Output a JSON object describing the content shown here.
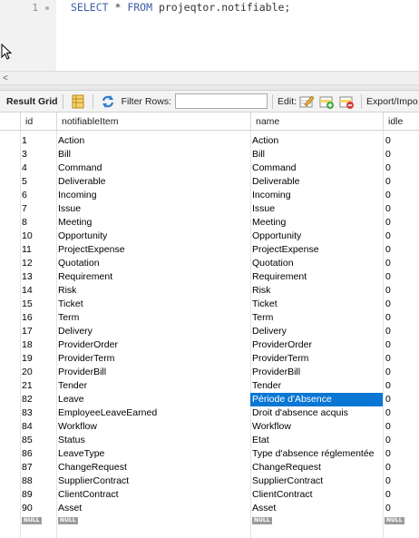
{
  "editor": {
    "line_number": "1",
    "sql_keyword_select": "SELECT",
    "sql_star": " * ",
    "sql_keyword_from": "FROM",
    "sql_table": " projeqtor.notifiable;"
  },
  "scrollbar": {
    "left_arrow": "<"
  },
  "toolbar": {
    "result_grid_label": "Result Grid",
    "filter_rows_label": "Filter Rows:",
    "filter_rows_value": "",
    "edit_label": "Edit:",
    "export_label": "Export/Impo"
  },
  "grid": {
    "columns": [
      "id",
      "notifiableItem",
      "name",
      "idle"
    ],
    "rows": [
      [
        "1",
        "Action",
        "Action",
        "0"
      ],
      [
        "3",
        "Bill",
        "Bill",
        "0"
      ],
      [
        "4",
        "Command",
        "Command",
        "0"
      ],
      [
        "5",
        "Deliverable",
        "Deliverable",
        "0"
      ],
      [
        "6",
        "Incoming",
        "Incoming",
        "0"
      ],
      [
        "7",
        "Issue",
        "Issue",
        "0"
      ],
      [
        "8",
        "Meeting",
        "Meeting",
        "0"
      ],
      [
        "10",
        "Opportunity",
        "Opportunity",
        "0"
      ],
      [
        "11",
        "ProjectExpense",
        "ProjectExpense",
        "0"
      ],
      [
        "12",
        "Quotation",
        "Quotation",
        "0"
      ],
      [
        "13",
        "Requirement",
        "Requirement",
        "0"
      ],
      [
        "14",
        "Risk",
        "Risk",
        "0"
      ],
      [
        "15",
        "Ticket",
        "Ticket",
        "0"
      ],
      [
        "16",
        "Term",
        "Term",
        "0"
      ],
      [
        "17",
        "Delivery",
        "Delivery",
        "0"
      ],
      [
        "18",
        "ProviderOrder",
        "ProviderOrder",
        "0"
      ],
      [
        "19",
        "ProviderTerm",
        "ProviderTerm",
        "0"
      ],
      [
        "20",
        "ProviderBill",
        "ProviderBill",
        "0"
      ],
      [
        "21",
        "Tender",
        "Tender",
        "0"
      ],
      [
        "82",
        "Leave",
        "Période d'Absence",
        "0"
      ],
      [
        "83",
        "EmployeeLeaveEarned",
        "Droit d'absence acquis",
        "0"
      ],
      [
        "84",
        "Workflow",
        "Workflow",
        "0"
      ],
      [
        "85",
        "Status",
        "Etat",
        "0"
      ],
      [
        "86",
        "LeaveType",
        "Type d'absence réglementée",
        "0"
      ],
      [
        "87",
        "ChangeRequest",
        "ChangeRequest",
        "0"
      ],
      [
        "88",
        "SupplierContract",
        "SupplierContract",
        "0"
      ],
      [
        "89",
        "ClientContract",
        "ClientContract",
        "0"
      ],
      [
        "90",
        "Asset",
        "Asset",
        "0"
      ]
    ],
    "selected_row": 19,
    "selected_col": 2,
    "null_label": "NULL"
  },
  "colors": {
    "selection": "#0b77d4",
    "keyword": "#3c5ea6"
  },
  "icons": [
    "grid-view-icon",
    "refresh-icon",
    "edit-row-icon",
    "add-row-icon",
    "delete-row-icon"
  ]
}
